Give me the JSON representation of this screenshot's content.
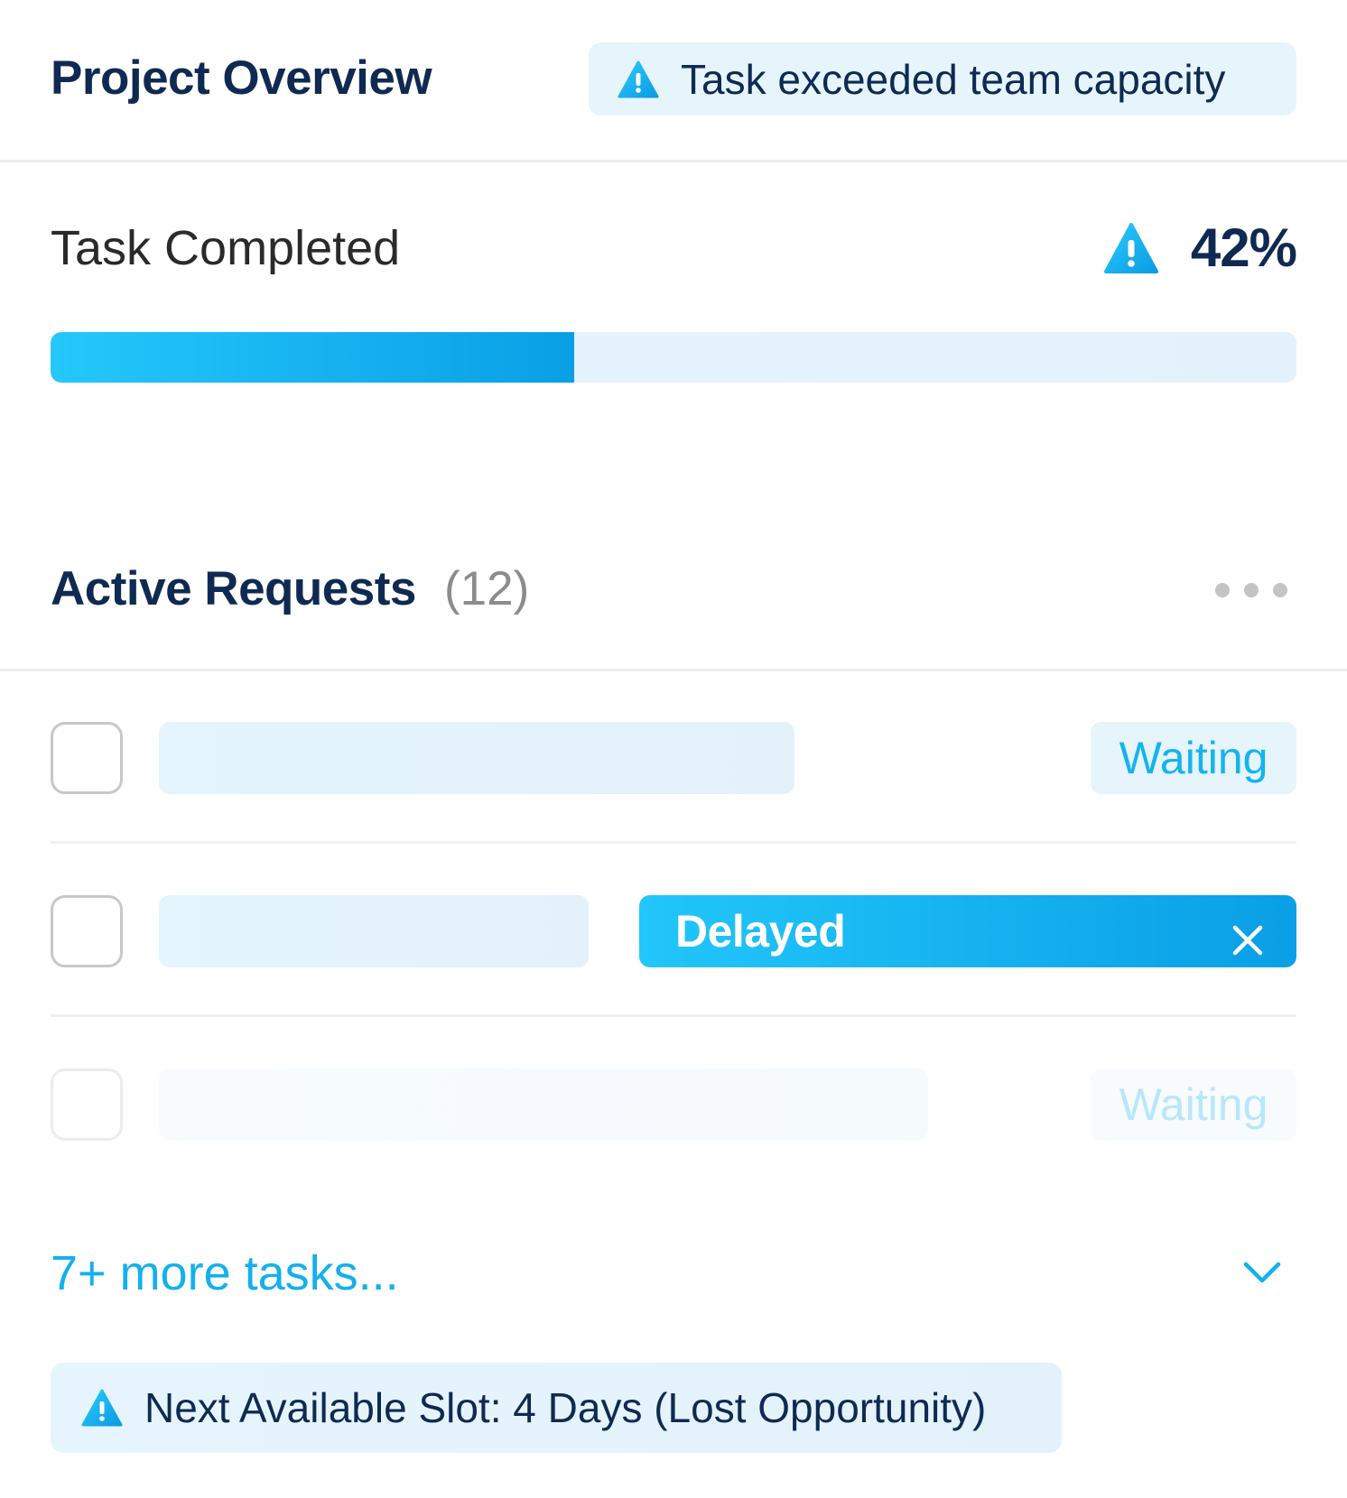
{
  "header": {
    "title": "Project Overview",
    "alert": {
      "icon": "warning-icon",
      "text": "Task exceeded team capacity"
    }
  },
  "progress": {
    "label": "Task Completed",
    "warning_icon": "warning-icon",
    "value_text": "42%",
    "fraction_filled": 0.42
  },
  "requests": {
    "title": "Active Requests",
    "count": "(12)",
    "menu_icon": "more-horizontal-icon",
    "rows": [
      {
        "checked": false,
        "status": "Waiting"
      },
      {
        "checked": false,
        "status": "Delayed",
        "status_icon": "close-icon"
      },
      {
        "checked": false,
        "status": "Waiting"
      }
    ],
    "more_tasks": "7+ more tasks...",
    "expand_icon": "chevron-down-icon"
  },
  "footer_alert": {
    "icon": "warning-icon",
    "text": "Next Available Slot: 4 Days (Lost Opportunity)"
  },
  "colors": {
    "accent": "#14b0ee",
    "accent_gradient_start": "#24c8fb",
    "accent_gradient_end": "#0a9fe6",
    "navy": "#0f2a52",
    "light_fill": "#e6f4fc"
  }
}
